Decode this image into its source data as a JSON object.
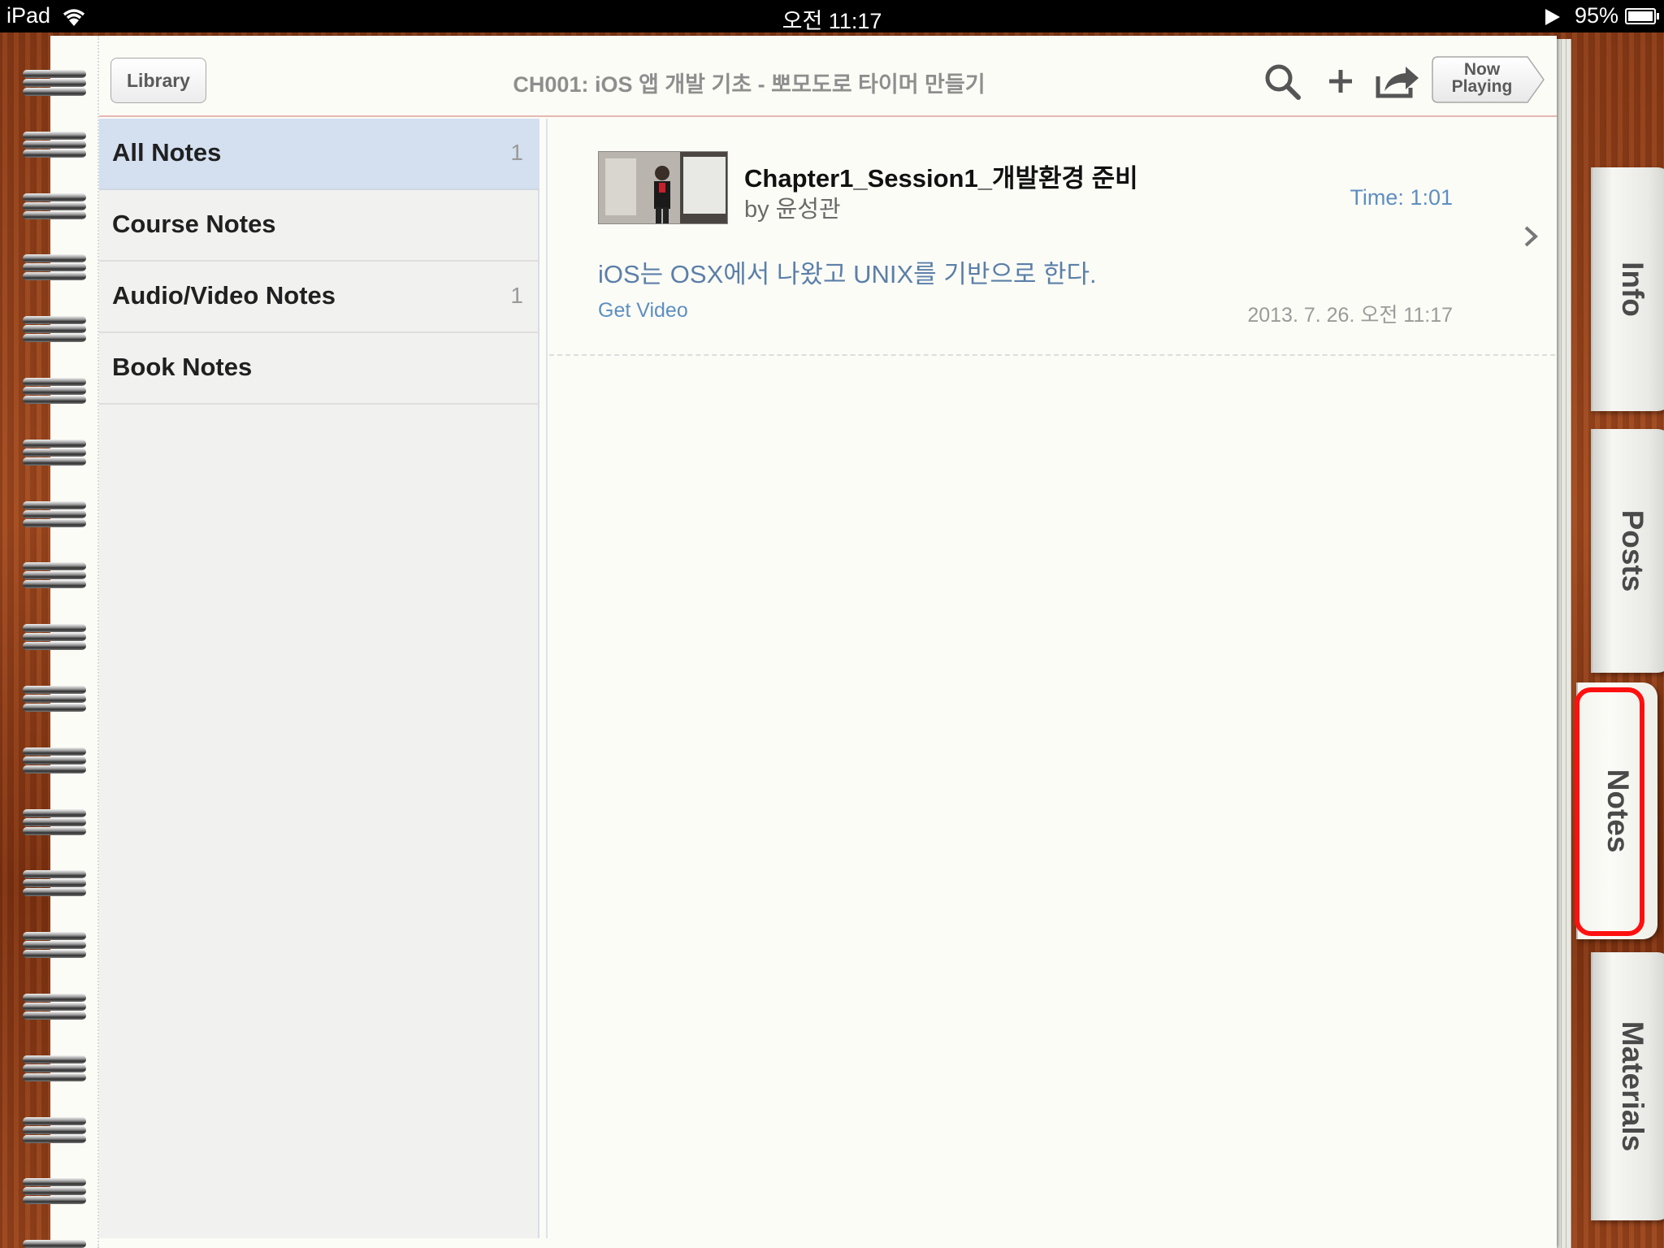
{
  "status_bar": {
    "device": "iPad",
    "time": "오전 11:17",
    "battery": "95%"
  },
  "toolbar": {
    "library_label": "Library",
    "title": "CH001: iOS 앱 개발 기초 - 뽀모도로 타이머 만들기",
    "now_playing_line1": "Now",
    "now_playing_line2": "Playing",
    "icons": [
      "search-icon",
      "add-icon",
      "share-icon"
    ]
  },
  "sidebar": {
    "items": [
      {
        "label": "All Notes",
        "count": "1",
        "selected": true
      },
      {
        "label": "Course Notes",
        "count": ""
      },
      {
        "label": "Audio/Video Notes",
        "count": "1"
      },
      {
        "label": "Book Notes",
        "count": ""
      }
    ]
  },
  "note": {
    "title": "Chapter1_Session1_개발환경 준비",
    "author": "by 윤성관",
    "time": "Time: 1:01",
    "text": "iOS는 OSX에서 나왔고 UNIX를 기반으로 한다.",
    "link": "Get Video",
    "date": "2013. 7. 26. 오전 11:17"
  },
  "tabs": [
    {
      "label": "Info"
    },
    {
      "label": "Posts"
    },
    {
      "label": "Notes",
      "active": true
    },
    {
      "label": "Materials"
    }
  ],
  "colors": {
    "accent_link": "#5e8fc0",
    "selected_row": "#d4e0f0",
    "highlight": "#ff1010",
    "wood": "#9a451c"
  }
}
